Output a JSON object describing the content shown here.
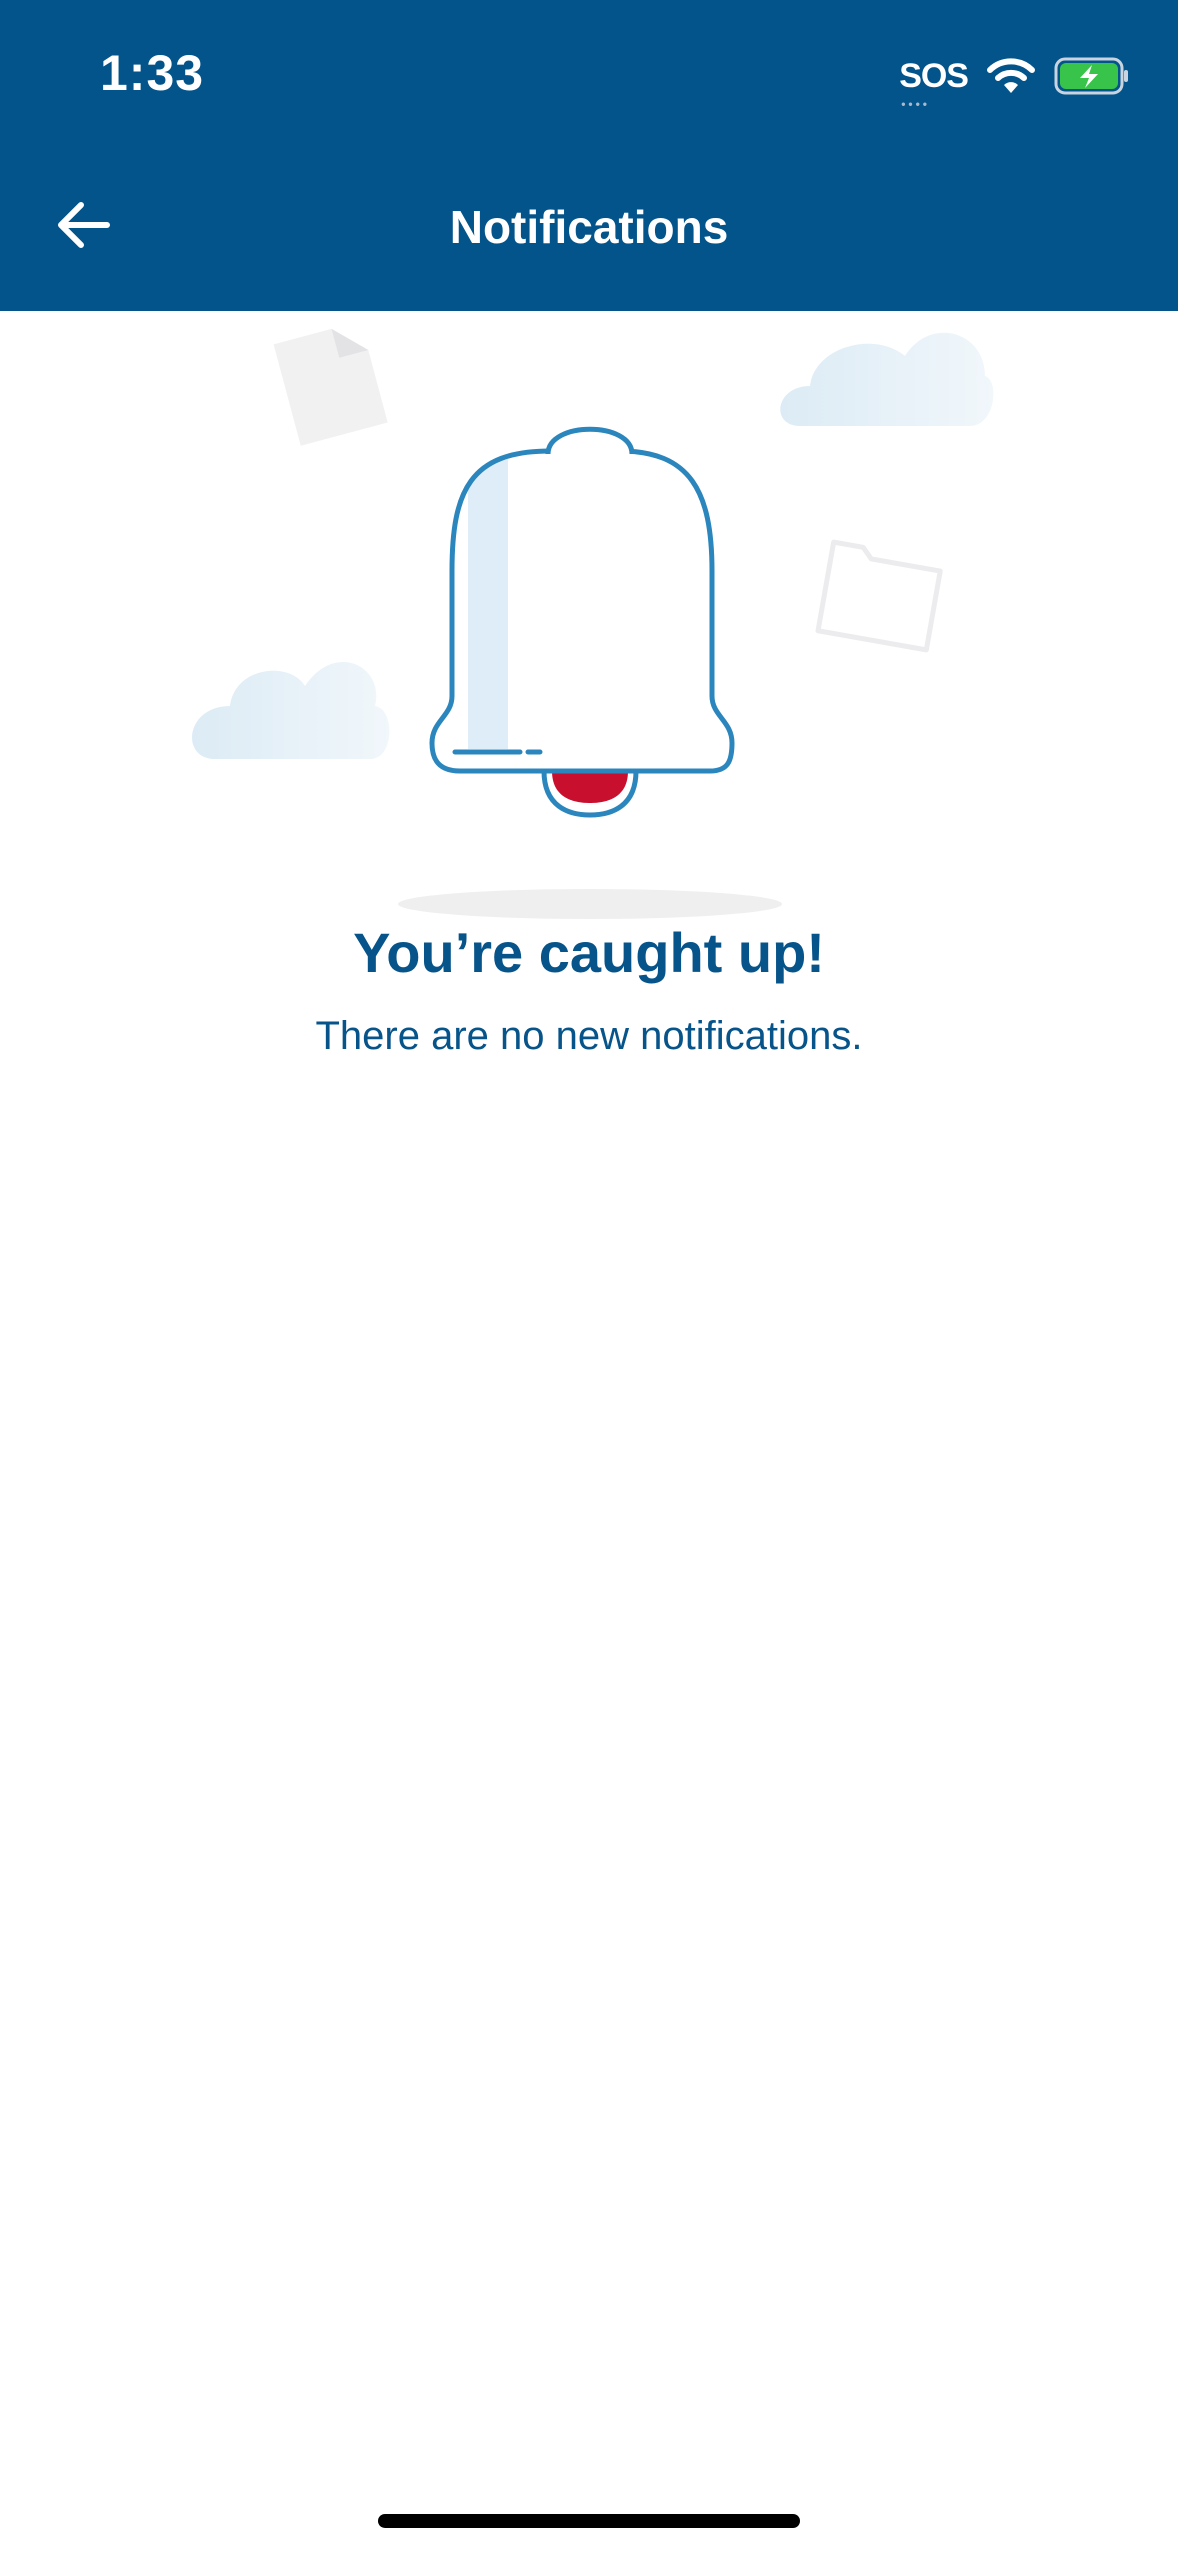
{
  "status_bar": {
    "time": "1:33",
    "sos_label": "SOS",
    "icons": [
      "wifi-icon",
      "battery-charging-icon"
    ]
  },
  "header": {
    "title": "Notifications",
    "back_icon": "arrow-left-icon",
    "background_color": "#02548a"
  },
  "empty_state": {
    "title": "You’re caught up!",
    "subtitle": "There are no new notifications.",
    "illustration": "bell-icon",
    "text_color": "#07548a",
    "accent_color": "#c8102e"
  }
}
